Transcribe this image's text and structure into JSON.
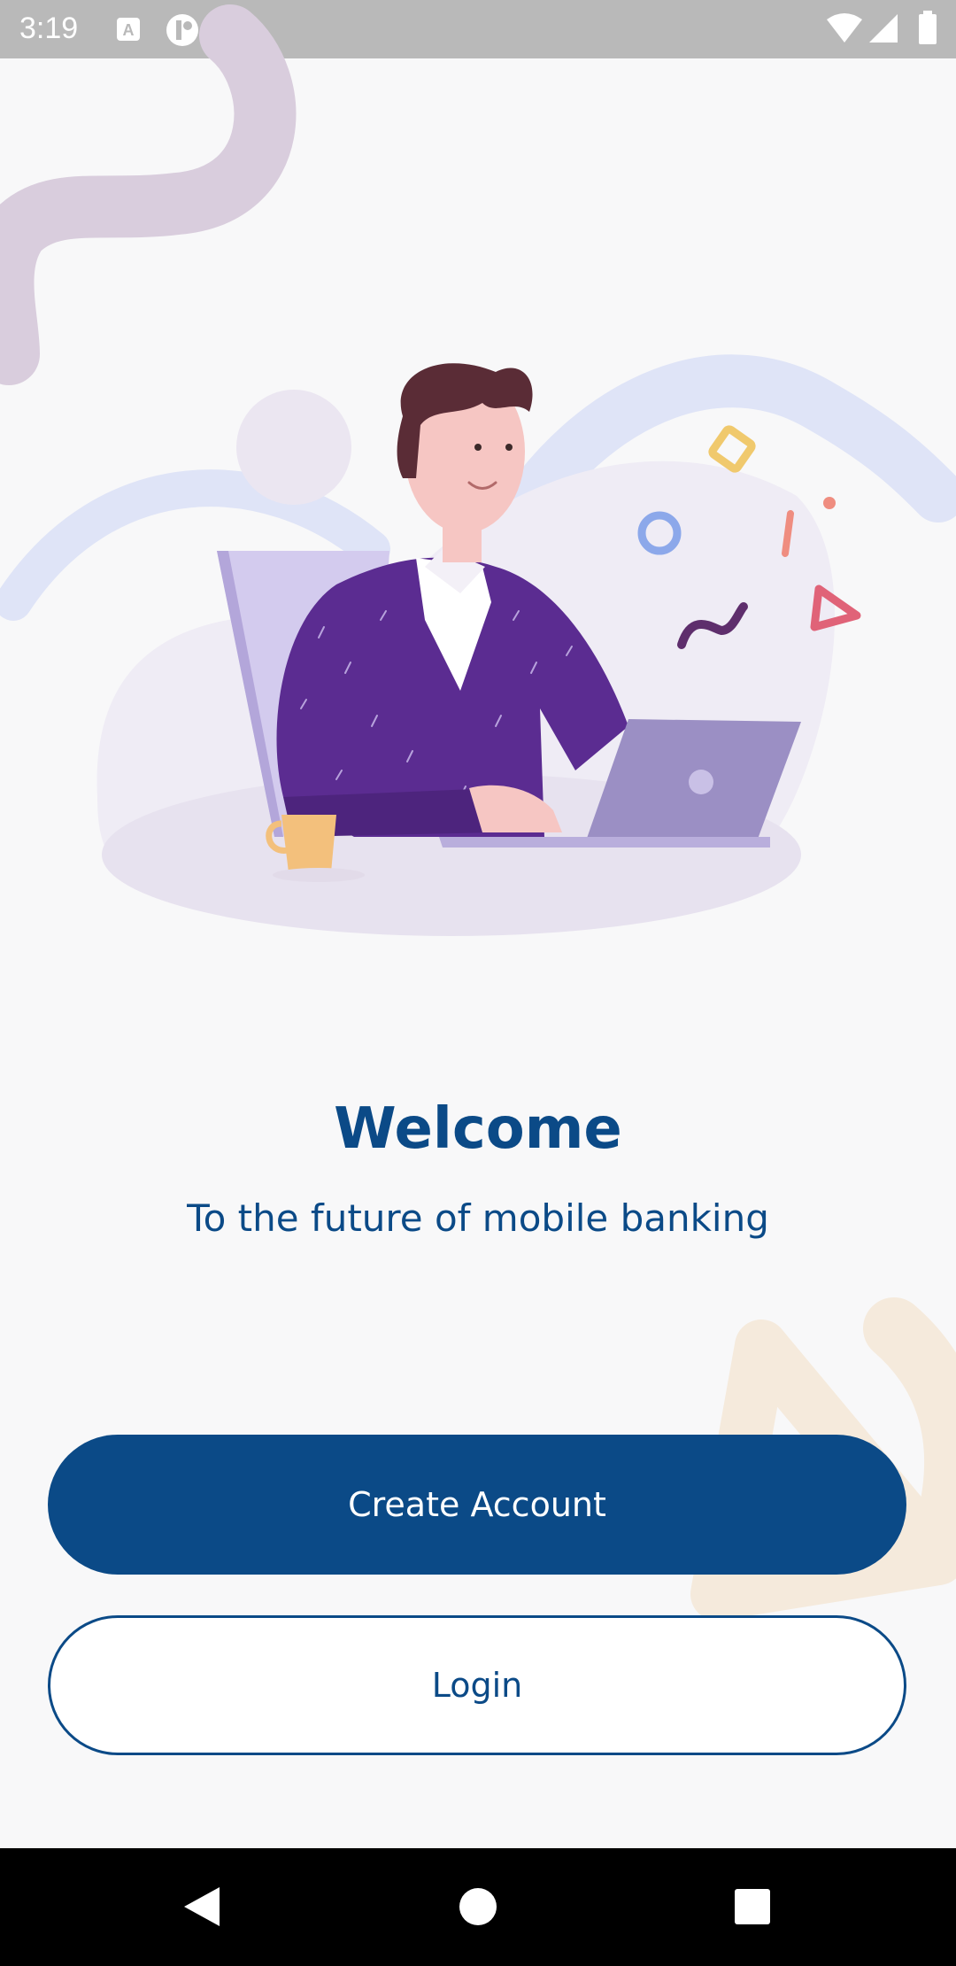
{
  "status_bar": {
    "time": "3:19",
    "icons": [
      "a-notification-icon",
      "app-notification-icon",
      "wifi-icon",
      "signal-icon",
      "battery-icon"
    ]
  },
  "welcome": {
    "title": "Welcome",
    "subtitle": "To the future of mobile banking"
  },
  "actions": {
    "create_account_label": "Create Account",
    "login_label": "Login"
  },
  "colors": {
    "primary": "#0b4a87",
    "background": "#f8f8f9",
    "illustration_purple": "#5b2c91",
    "laptop": "#9b8fc4"
  },
  "nav_bar": {
    "icons": [
      "back-icon",
      "home-icon",
      "recents-icon"
    ]
  }
}
